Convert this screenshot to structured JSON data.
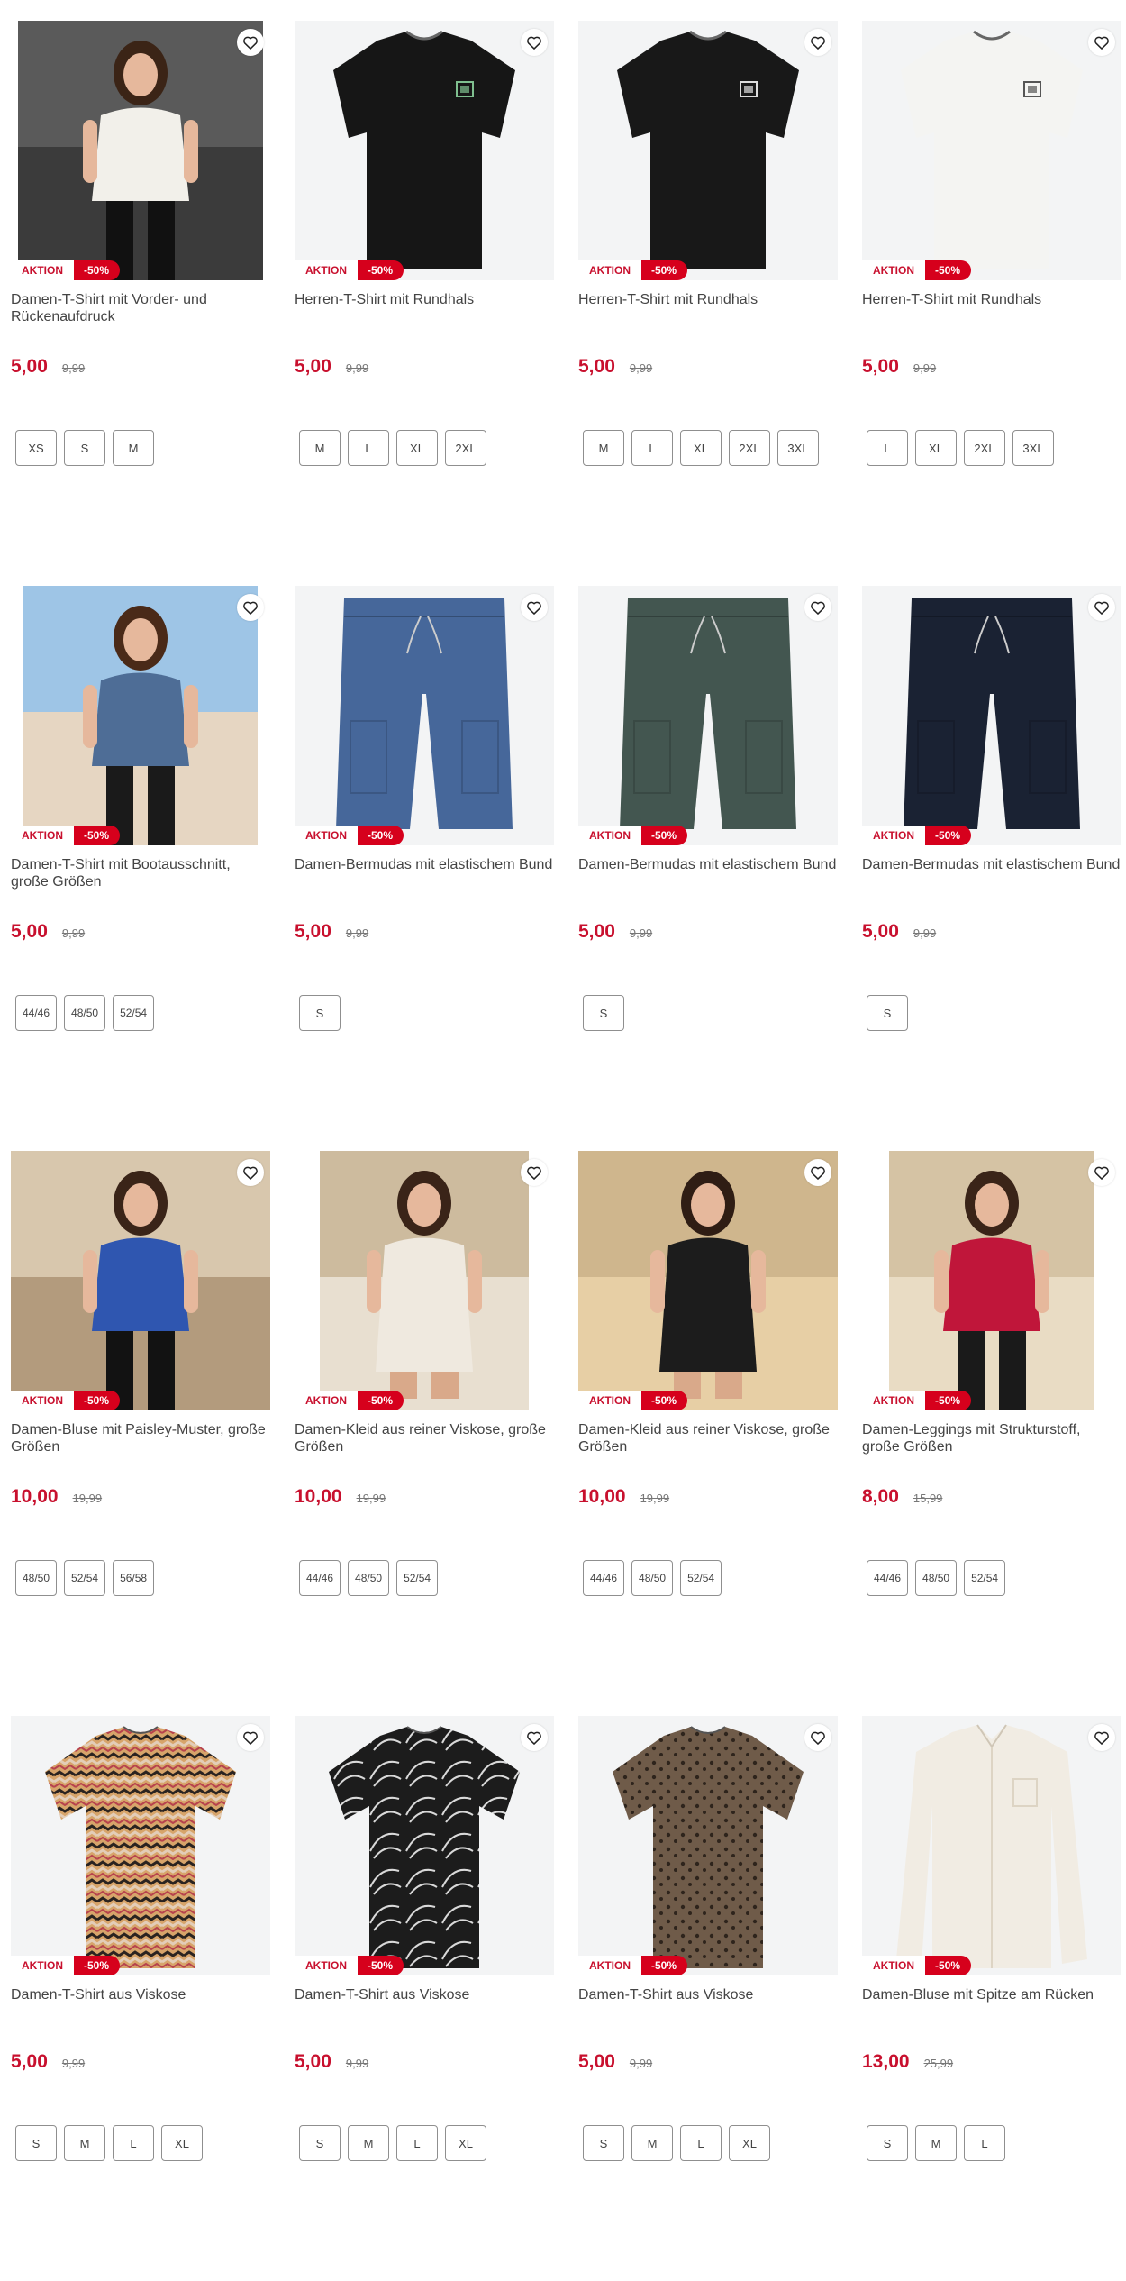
{
  "labels": {
    "badge_action": "AKTION",
    "badge_discount": "-50%"
  },
  "colors": {
    "price": "#c8102e",
    "badge_bg": "#d6001c"
  },
  "products": [
    {
      "title": "Damen-T-Shirt mit Vorder- und Rückenaufdruck",
      "price": "5,00",
      "old_price": "9,99",
      "sizes": [
        "XS",
        "S",
        "M"
      ],
      "image": "woman-white-tshirt-photo"
    },
    {
      "title": "Herren-T-Shirt mit Rundhals",
      "price": "5,00",
      "old_price": "9,99",
      "sizes": [
        "M",
        "L",
        "XL",
        "2XL"
      ],
      "image": "black-tshirt-green-print"
    },
    {
      "title": "Herren-T-Shirt mit Rundhals",
      "price": "5,00",
      "old_price": "9,99",
      "sizes": [
        "M",
        "L",
        "XL",
        "2XL",
        "3XL"
      ],
      "image": "black-tshirt-white-print"
    },
    {
      "title": "Herren-T-Shirt mit Rundhals",
      "price": "5,00",
      "old_price": "9,99",
      "sizes": [
        "L",
        "XL",
        "2XL",
        "3XL"
      ],
      "image": "white-tshirt"
    },
    {
      "title": "Damen-T-Shirt mit Bootausschnitt, große Größen",
      "price": "5,00",
      "old_price": "9,99",
      "sizes": [
        "44/46",
        "48/50",
        "52/54"
      ],
      "image": "woman-blue-top-photo"
    },
    {
      "title": "Damen-Bermudas mit elastischem Bund",
      "price": "5,00",
      "old_price": "9,99",
      "sizes": [
        "S"
      ],
      "image": "blue-bermudas"
    },
    {
      "title": "Damen-Bermudas mit elastischem Bund",
      "price": "5,00",
      "old_price": "9,99",
      "sizes": [
        "S"
      ],
      "image": "green-bermudas"
    },
    {
      "title": "Damen-Bermudas mit elastischem Bund",
      "price": "5,00",
      "old_price": "9,99",
      "sizes": [
        "S"
      ],
      "image": "navy-bermudas"
    },
    {
      "title": "Damen-Bluse mit Paisley-Muster, große Größen",
      "price": "10,00",
      "old_price": "19,99",
      "sizes": [
        "48/50",
        "52/54",
        "56/58"
      ],
      "image": "woman-paisley-blouse-photo"
    },
    {
      "title": "Damen-Kleid aus reiner Viskose, große Größen",
      "price": "10,00",
      "old_price": "19,99",
      "sizes": [
        "44/46",
        "48/50",
        "52/54"
      ],
      "image": "woman-patterned-dress-photo"
    },
    {
      "title": "Damen-Kleid aus reiner Viskose, große Größen",
      "price": "10,00",
      "old_price": "19,99",
      "sizes": [
        "44/46",
        "48/50",
        "52/54"
      ],
      "image": "woman-black-dress-photo"
    },
    {
      "title": "Damen-Leggings mit Strukturstoff, große Größen",
      "price": "8,00",
      "old_price": "15,99",
      "sizes": [
        "44/46",
        "48/50",
        "52/54"
      ],
      "image": "woman-black-leggings-photo"
    },
    {
      "title": "Damen-T-Shirt aus Viskose",
      "price": "5,00",
      "old_price": "9,99",
      "sizes": [
        "S",
        "M",
        "L",
        "XL"
      ],
      "image": "zigzag-tshirt"
    },
    {
      "title": "Damen-T-Shirt aus Viskose",
      "price": "5,00",
      "old_price": "9,99",
      "sizes": [
        "S",
        "M",
        "L",
        "XL"
      ],
      "image": "black-white-pattern-tshirt"
    },
    {
      "title": "Damen-T-Shirt aus Viskose",
      "price": "5,00",
      "old_price": "9,99",
      "sizes": [
        "S",
        "M",
        "L",
        "XL"
      ],
      "image": "brown-leopard-tshirt"
    },
    {
      "title": "Damen-Bluse mit Spitze am Rücken",
      "price": "13,00",
      "old_price": "25,99",
      "sizes": [
        "S",
        "M",
        "L"
      ],
      "image": "cream-blouse"
    }
  ]
}
